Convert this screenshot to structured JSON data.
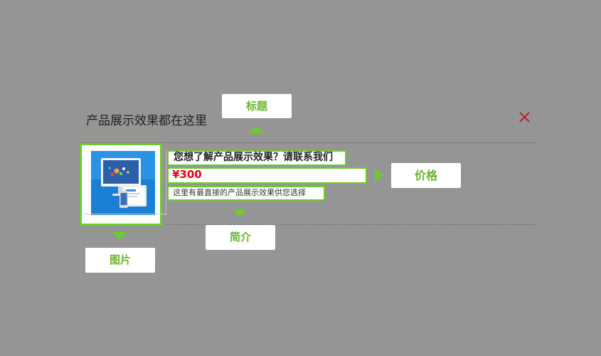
{
  "panel": {
    "title": "产品展示效果都在这里"
  },
  "product": {
    "title": "您想了解产品展示效果？请联系我们",
    "price": "¥300",
    "intro": "这里有最直接的产品展示效果供您选择",
    "image_icon": "monitor-and-devices-image"
  },
  "callouts": {
    "title": "标题",
    "price": "价格",
    "intro": "简介",
    "image": "图片"
  },
  "icons": {
    "close": "close-icon"
  },
  "colors": {
    "overlay": "#959595",
    "accent_green": "#6ccc2b",
    "callout_text": "#6ab52c",
    "price_red": "#e60012",
    "close_red": "#c0101a"
  }
}
